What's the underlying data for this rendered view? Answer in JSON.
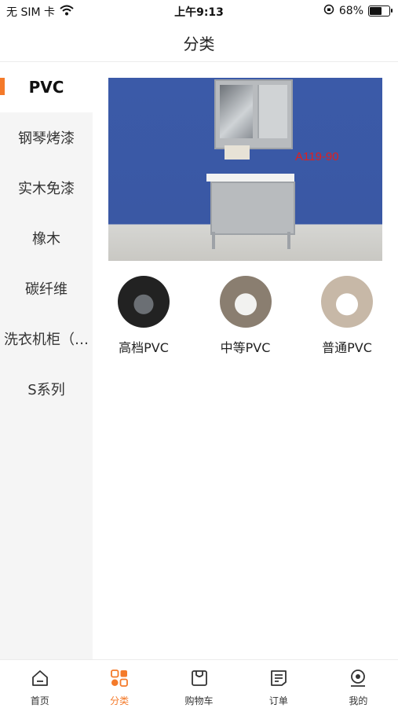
{
  "status_bar": {
    "carrier": "无 SIM 卡",
    "time": "上午9:13",
    "battery_percent": "68%",
    "battery_level": 0.68
  },
  "nav": {
    "title": "分类"
  },
  "sidebar": {
    "items": [
      {
        "label": "PVC",
        "active": true
      },
      {
        "label": "钢琴烤漆",
        "active": false
      },
      {
        "label": "实木免漆",
        "active": false
      },
      {
        "label": "橡木",
        "active": false
      },
      {
        "label": "碳纤维",
        "active": false
      },
      {
        "label": "洗衣机柜（…",
        "active": false
      },
      {
        "label": "S系列",
        "active": false
      }
    ]
  },
  "banner": {
    "tag_text": "A119-90"
  },
  "subcategories": [
    {
      "label": "高档PVC"
    },
    {
      "label": "中等PVC"
    },
    {
      "label": "普通PVC"
    }
  ],
  "tab_bar": {
    "accent": "#f47a2a",
    "items": [
      {
        "label": "首页",
        "icon": "home-icon",
        "active": false
      },
      {
        "label": "分类",
        "icon": "category-icon",
        "active": true
      },
      {
        "label": "购物车",
        "icon": "cart-icon",
        "active": false
      },
      {
        "label": "订单",
        "icon": "order-icon",
        "active": false
      },
      {
        "label": "我的",
        "icon": "profile-icon",
        "active": false
      }
    ]
  }
}
